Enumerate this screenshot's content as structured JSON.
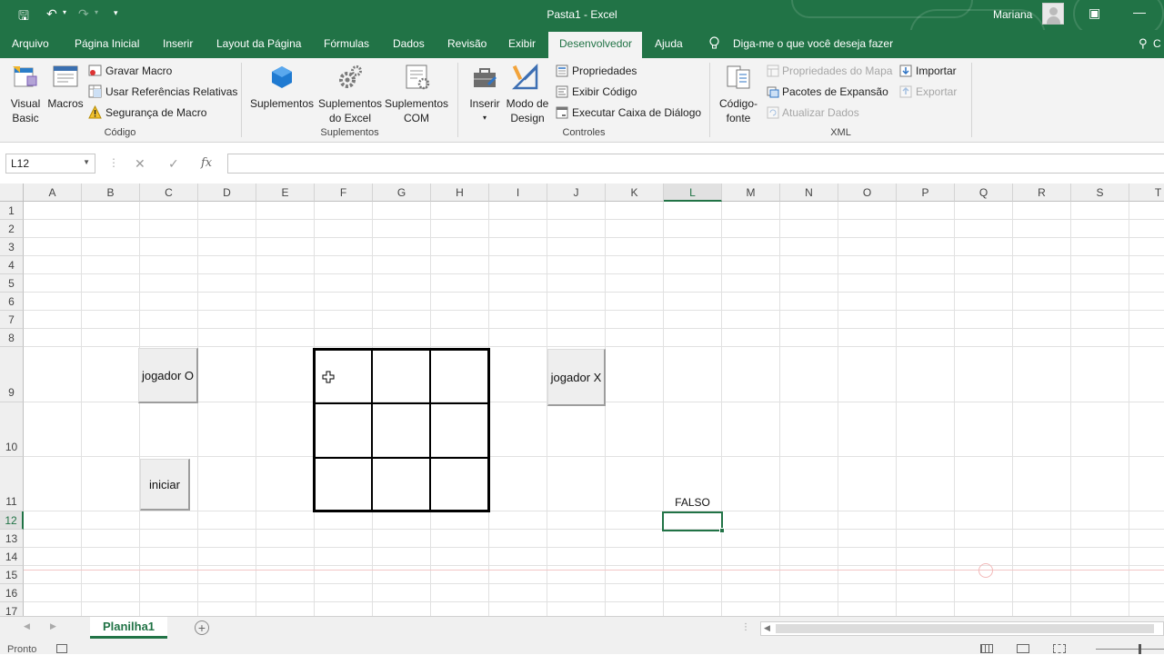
{
  "title_bar": {
    "title": "Pasta1  -  Excel",
    "user": "Mariana",
    "qa_save": "🖫",
    "qa_undo": "↶",
    "qa_redo": "↷",
    "qa_more": "▾",
    "win_mode": "▣",
    "win_min": "—"
  },
  "tabs": [
    {
      "label": "Arquivo"
    },
    {
      "label": "Página Inicial"
    },
    {
      "label": "Inserir"
    },
    {
      "label": "Layout da Página"
    },
    {
      "label": "Fórmulas"
    },
    {
      "label": "Dados"
    },
    {
      "label": "Revisão"
    },
    {
      "label": "Exibir"
    },
    {
      "label": "Desenvolvedor"
    },
    {
      "label": "Ajuda"
    }
  ],
  "tell_me": "Diga-me o que você deseja fazer",
  "share_label": "C",
  "ribbon": {
    "codigo": {
      "visual_basic": [
        "Visual",
        "Basic"
      ],
      "macros": "Macros",
      "gravar_macro": "Gravar Macro",
      "usar_referencias": "Usar Referências Relativas",
      "seguranca": "Segurança de Macro",
      "group_label": "Código"
    },
    "suplementos": {
      "suplementos": "Suplementos",
      "suplementos_excel": [
        "Suplementos",
        "do Excel"
      ],
      "suplementos_com": [
        "Suplementos",
        "COM"
      ],
      "group_label": "Suplementos"
    },
    "controles": {
      "inserir": "Inserir",
      "modo_design": [
        "Modo de",
        "Design"
      ],
      "propriedades": "Propriedades",
      "exibir_codigo": "Exibir Código",
      "executar_caixa": "Executar Caixa de Diálogo",
      "group_label": "Controles"
    },
    "xml": {
      "codigo_fonte": [
        "Código-",
        "fonte"
      ],
      "propriedades_mapa": "Propriedades do Mapa",
      "pacotes_expansao": "Pacotes de Expansão",
      "atualizar_dados": "Atualizar Dados",
      "importar": "Importar",
      "exportar": "Exportar",
      "group_label": "XML"
    }
  },
  "formula_bar": {
    "name_box": "L12",
    "cancel_icon": "✕",
    "enter_icon": "✓",
    "fx_label": "fx",
    "formula": ""
  },
  "sheet": {
    "columns": [
      "A",
      "B",
      "C",
      "D",
      "E",
      "F",
      "G",
      "H",
      "I",
      "J",
      "K",
      "L",
      "M",
      "N",
      "O",
      "P",
      "Q",
      "R",
      "S",
      "T"
    ],
    "rows": [
      "1",
      "2",
      "3",
      "4",
      "5",
      "6",
      "7",
      "8",
      "9",
      "10",
      "11",
      "12",
      "13",
      "14",
      "15",
      "16",
      "17"
    ],
    "selected_cell": "L12",
    "cells": [
      {
        "ref": "L11",
        "value": "FALSO"
      }
    ],
    "buttons": {
      "jogador_o": "jogador O",
      "jogador_x": "jogador X",
      "iniciar": "iniciar"
    }
  },
  "sheet_tabs": [
    {
      "label": "Planilha1",
      "active": true
    }
  ],
  "status_bar": {
    "status": "Pronto"
  }
}
